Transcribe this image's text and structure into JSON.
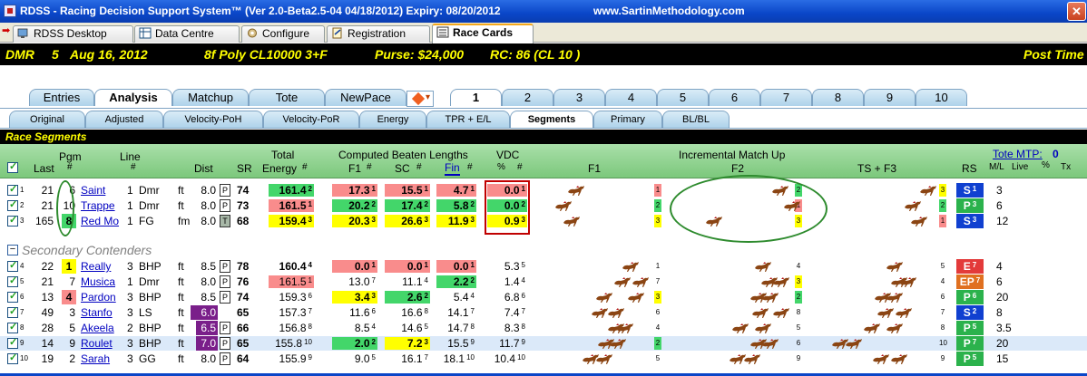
{
  "window": {
    "title": "RDSS - Racing Decision Support System™ (Ver 2.0-Beta2.5-04  04/18/2012)  Expiry: 08/20/2012",
    "site": "www.SartinMethodology.com",
    "close": "✕"
  },
  "main_tabs": [
    {
      "label": "RDSS Desktop"
    },
    {
      "label": "Data Centre"
    },
    {
      "label": "Configure"
    },
    {
      "label": "Registration"
    },
    {
      "label": "Race Cards"
    }
  ],
  "race": {
    "track": "DMR",
    "race_no": "5",
    "date": "Aug 16, 2012",
    "conditions": "8f  Poly  CL10000  3+F",
    "purse": "Purse: $24,000",
    "rc": "RC: 86  (CL 10 )",
    "post_time": "Post Time"
  },
  "view_tabs": [
    "Entries",
    "Analysis",
    "Matchup",
    "Tote",
    "NewPace"
  ],
  "race_tabs": [
    "1",
    "2",
    "3",
    "4",
    "5",
    "6",
    "7",
    "8",
    "9",
    "10"
  ],
  "sub_tabs": [
    "Original",
    "Adjusted",
    "Velocity-PoH",
    "Velocity-PoR",
    "Energy",
    "TPR + E/L",
    "Segments",
    "Primary",
    "BL/BL"
  ],
  "section_title": "Race Segments",
  "headers": {
    "last": "Last",
    "pgm": "Pgm",
    "pgm_hash": "#",
    "line": "Line",
    "line_hash": "#",
    "dist": "Dist",
    "sr": "SR",
    "total": "Total",
    "energy": "Energy",
    "energy_hash": "#",
    "cbl": "Computed Beaten Lengths",
    "f1": "F1",
    "f1_hash": "#",
    "sc": "SC",
    "sc_hash": "#",
    "fin": "Fin",
    "fin_hash": "#",
    "vdc": "VDC",
    "vdc_pct": "%",
    "vdc_hash": "#",
    "imu": "Incremental Match Up",
    "imu_f1": "F1",
    "imu_f2": "F2",
    "imu_ts": "TS + F3",
    "rs": "RS",
    "tote_mtp": "Tote MTP:",
    "tote_mtp_val": "0",
    "ml": "M/L",
    "live": "Live",
    "pct": "%",
    "tx": "Tx"
  },
  "secondary_label": "Secondary Contenders",
  "colors": {
    "pink": "#f98c8c",
    "green": "#43d66a",
    "yellow": "#ffff00",
    "purple": "#7a1f8a"
  },
  "rows": [
    {
      "rn": "1",
      "last": "21",
      "pgm": "6",
      "name": "Saint",
      "line": "1",
      "trk": "Dmr",
      "surf": "ft",
      "dist": "8.0",
      "sb": "P",
      "sr": "74",
      "en": "161.4",
      "enr": "2",
      "f1": "17.3",
      "f1r": "1",
      "sc": "15.5",
      "scr": "1",
      "fin": "4.7",
      "finr": "1",
      "vdc": "0.0",
      "vdcr": "1",
      "m1": "1",
      "m2": "2",
      "m3": "3",
      "rs": "S",
      "rsr": "1",
      "ml": "3"
    },
    {
      "rn": "2",
      "last": "21",
      "pgm": "10",
      "name": "Trappe",
      "line": "1",
      "trk": "Dmr",
      "surf": "ft",
      "dist": "8.0",
      "sb": "P",
      "sr": "73",
      "en": "161.5",
      "enr": "1",
      "f1": "20.2",
      "f1r": "2",
      "sc": "17.4",
      "scr": "2",
      "fin": "5.8",
      "finr": "2",
      "vdc": "0.0",
      "vdcr": "2",
      "m1": "2",
      "m2": "1",
      "m3": "2",
      "rs": "P",
      "rsr": "3",
      "ml": "6"
    },
    {
      "rn": "3",
      "last": "165",
      "pgm": "8",
      "name": "Red Mo",
      "line": "1",
      "trk": "FG",
      "surf": "fm",
      "dist": "8.0",
      "sb": "T",
      "sr": "68",
      "en": "159.4",
      "enr": "3",
      "f1": "20.3",
      "f1r": "3",
      "sc": "26.6",
      "scr": "3",
      "fin": "11.9",
      "finr": "3",
      "vdc": "0.9",
      "vdcr": "3",
      "m1": "3",
      "m2": "3",
      "m3": "1",
      "rs": "S",
      "rsr": "3",
      "ml": "12"
    },
    {
      "rn": "4",
      "last": "22",
      "pgm": "1",
      "name": "Really",
      "line": "3",
      "trk": "BHP",
      "surf": "ft",
      "dist": "8.5",
      "sb": "P",
      "sr": "78",
      "en": "160.4",
      "enr": "4",
      "f1": "0.0",
      "f1r": "1",
      "sc": "0.0",
      "scr": "1",
      "fin": "0.0",
      "finr": "1",
      "vdc": "5.3",
      "vdcr": "5",
      "m1": "1",
      "m2": "4",
      "m3": "5",
      "rs": "E",
      "rsr": "7",
      "ml": "4"
    },
    {
      "rn": "5",
      "last": "21",
      "pgm": "7",
      "name": "Musica",
      "line": "1",
      "trk": "Dmr",
      "surf": "ft",
      "dist": "8.0",
      "sb": "P",
      "sr": "76",
      "en": "161.5",
      "enr": "1",
      "f1": "13.0",
      "f1r": "7",
      "sc": "11.1",
      "scr": "4",
      "fin": "2.2",
      "finr": "2",
      "vdc": "1.4",
      "vdcr": "4",
      "m1": "7",
      "m2": "3",
      "m3": "4",
      "rs": "EP",
      "rsr": "7",
      "ml": "6"
    },
    {
      "rn": "6",
      "last": "13",
      "pgm": "4",
      "name": "Pardon",
      "line": "3",
      "trk": "BHP",
      "surf": "ft",
      "dist": "8.5",
      "sb": "P",
      "sr": "74",
      "en": "159.3",
      "enr": "6",
      "f1": "3.4",
      "f1r": "3",
      "sc": "2.6",
      "scr": "2",
      "fin": "5.4",
      "finr": "4",
      "vdc": "6.8",
      "vdcr": "6",
      "m1": "3",
      "m2": "2",
      "m3": "6",
      "rs": "P",
      "rsr": "6",
      "ml": "20"
    },
    {
      "rn": "7",
      "last": "49",
      "pgm": "3",
      "name": "Stanfo",
      "line": "3",
      "trk": "LS",
      "surf": "ft",
      "dist": "6.0",
      "sb": "",
      "sr": "65",
      "en": "157.3",
      "enr": "7",
      "f1": "11.6",
      "f1r": "6",
      "sc": "16.6",
      "scr": "8",
      "fin": "14.1",
      "finr": "7",
      "vdc": "7.4",
      "vdcr": "7",
      "m1": "6",
      "m2": "8",
      "m3": "7",
      "rs": "S",
      "rsr": "2",
      "ml": "8"
    },
    {
      "rn": "8",
      "last": "28",
      "pgm": "5",
      "name": "Akeela",
      "line": "2",
      "trk": "BHP",
      "surf": "ft",
      "dist": "6.5",
      "sb": "P",
      "sr": "66",
      "en": "156.8",
      "enr": "8",
      "f1": "8.5",
      "f1r": "4",
      "sc": "14.6",
      "scr": "5",
      "fin": "14.7",
      "finr": "8",
      "vdc": "8.3",
      "vdcr": "8",
      "m1": "4",
      "m2": "5",
      "m3": "8",
      "rs": "P",
      "rsr": "5",
      "ml": "3.5"
    },
    {
      "rn": "9",
      "last": "14",
      "pgm": "9",
      "name": "Roulet",
      "line": "3",
      "trk": "BHP",
      "surf": "ft",
      "dist": "7.0",
      "sb": "P",
      "sr": "65",
      "en": "155.8",
      "enr": "10",
      "f1": "2.0",
      "f1r": "2",
      "sc": "7.2",
      "scr": "3",
      "fin": "15.5",
      "finr": "9",
      "vdc": "11.7",
      "vdcr": "9",
      "m1": "2",
      "m2": "6",
      "m3": "10",
      "rs": "P",
      "rsr": "7",
      "ml": "20"
    },
    {
      "rn": "10",
      "last": "19",
      "pgm": "2",
      "name": "Sarah",
      "line": "3",
      "trk": "GG",
      "surf": "ft",
      "dist": "8.0",
      "sb": "P",
      "sr": "64",
      "en": "155.9",
      "enr": "9",
      "f1": "9.0",
      "f1r": "5",
      "sc": "16.1",
      "scr": "7",
      "fin": "18.1",
      "finr": "10",
      "vdc": "10.4",
      "vdcr": "10",
      "m1": "5",
      "m2": "9",
      "m3": "9",
      "rs": "P",
      "rsr": "5",
      "ml": "15"
    }
  ]
}
